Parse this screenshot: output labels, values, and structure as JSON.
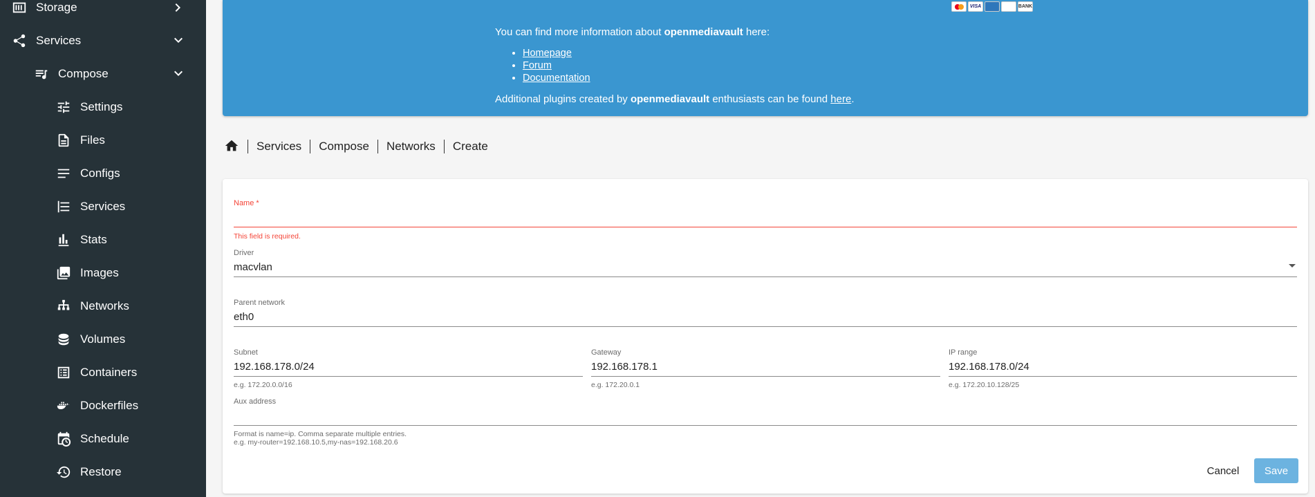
{
  "sidebar": {
    "storage": "Storage",
    "services": "Services",
    "compose": "Compose",
    "items": [
      "Settings",
      "Files",
      "Configs",
      "Services",
      "Stats",
      "Images",
      "Networks",
      "Volumes",
      "Containers",
      "Dockerfiles",
      "Schedule",
      "Restore"
    ]
  },
  "banner": {
    "pay_logos": [
      "MC",
      "VISA",
      "AMEX",
      "DISC",
      "BANK"
    ],
    "line1_pre": "You can find more information about ",
    "brand": "openmediavault",
    "line1_post": " here:",
    "links": [
      "Homepage",
      "Forum",
      "Documentation"
    ],
    "line2_pre": "Additional plugins created by ",
    "line2_mid": " enthusiasts can be found ",
    "line2_link": "here",
    "line2_post": "."
  },
  "breadcrumb": [
    "Services",
    "Compose",
    "Networks",
    "Create"
  ],
  "form": {
    "name_label": "Name *",
    "name_value": "",
    "name_error": "This field is required.",
    "driver_label": "Driver",
    "driver_value": "macvlan",
    "parent_label": "Parent network",
    "parent_value": "eth0",
    "subnet_label": "Subnet",
    "subnet_value": "192.168.178.0/24",
    "subnet_hint": "e.g. 172.20.0.0/16",
    "gateway_label": "Gateway",
    "gateway_value": "192.168.178.1",
    "gateway_hint": "e.g. 172.20.0.1",
    "iprange_label": "IP range",
    "iprange_value": "192.168.178.0/24",
    "iprange_hint": "e.g. 172.20.10.128/25",
    "aux_label": "Aux address",
    "aux_value": "",
    "aux_hint1": "Format is name=ip. Comma separate multiple entries.",
    "aux_hint2": "e.g. my-router=192.168.10.5,my-nas=192.168.20.6"
  },
  "buttons": {
    "cancel": "Cancel",
    "save": "Save"
  },
  "colors": {
    "sidebar_bg": "#263238",
    "banner_bg": "#3a96d0",
    "error": "#f44336",
    "save_bg": "#6cb3e0"
  }
}
